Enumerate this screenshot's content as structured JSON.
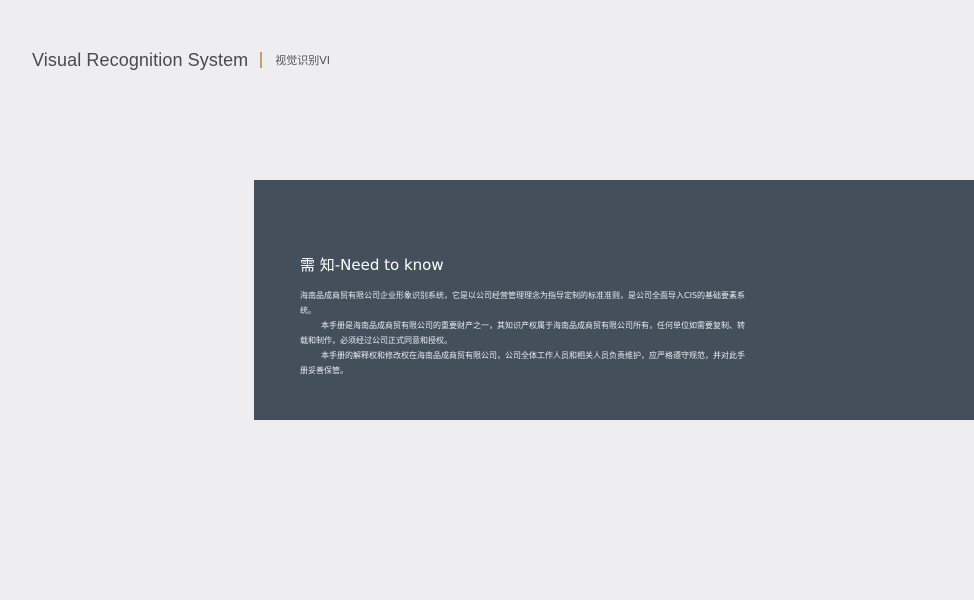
{
  "header": {
    "title": "Visual Recognition System",
    "subtitle": "视觉识别VI"
  },
  "panel": {
    "heading": "需 知-Need to know",
    "paragraphs": [
      "海南品成商贸有限公司企业形象识别系统，它是以公司经营管理理念为指导定制的标准准则，是公司全面导入CIS的基础要素系统。",
      "本手册是海南品成商贸有限公司的重要财产之一，其知识产权属于海南品成商贸有限公司所有，任何单位如需要复制、转载和制作，必须经过公司正式同意和授权。",
      "本手册的解释权和修改权在海南品成商贸有限公司，公司全体工作人员和相关人员负责维护，应严格遵守规范，并对此手册妥善保管。"
    ]
  },
  "colors": {
    "background": "#eeeef0",
    "panel": "#444f5c",
    "accent_divider": "#c9a063",
    "heading_text": "#ffffff",
    "body_text": "#e8eaee",
    "header_text": "#4a4a4a"
  }
}
